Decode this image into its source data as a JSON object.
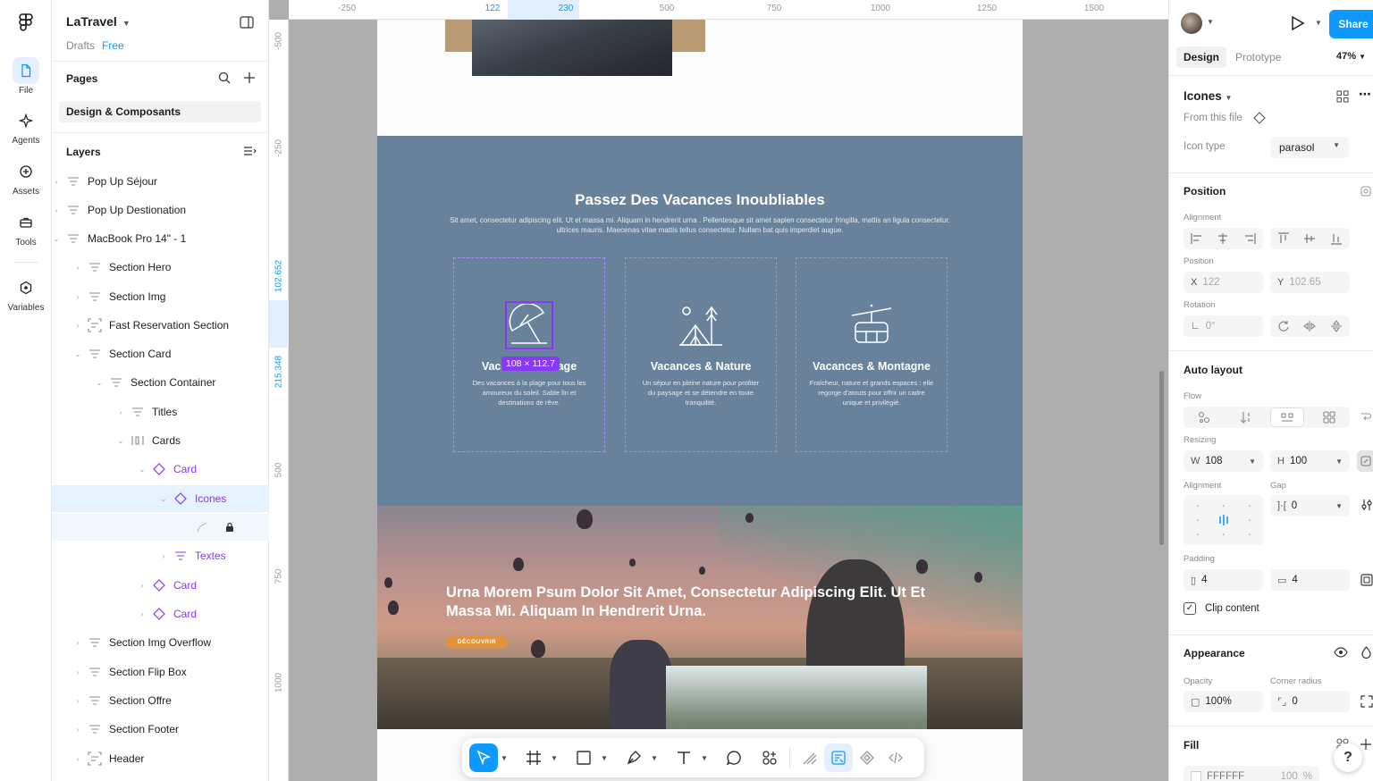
{
  "rail": {
    "items": [
      {
        "label": "File",
        "icon": "file-icon"
      },
      {
        "label": "Agents",
        "icon": "sparkle-icon"
      },
      {
        "label": "Assets",
        "icon": "assets-icon"
      },
      {
        "label": "Tools",
        "icon": "toolbox-icon"
      },
      {
        "label": "Variables",
        "icon": "variables-icon"
      }
    ]
  },
  "project": {
    "name": "LaTravel",
    "location": "Drafts",
    "plan": "Free"
  },
  "pages": {
    "title": "Pages",
    "current": "Design & Composants"
  },
  "layers": {
    "title": "Layers",
    "items": [
      {
        "label": "Pop Up Séjour"
      },
      {
        "label": "Pop Up Destionation"
      },
      {
        "label": "MacBook Pro 14\" - 1"
      },
      {
        "label": "Section Hero"
      },
      {
        "label": "Section Img"
      },
      {
        "label": "Fast Reservation Section"
      },
      {
        "label": "Section Card"
      },
      {
        "label": "Section Container"
      },
      {
        "label": "Titles"
      },
      {
        "label": "Cards"
      },
      {
        "label": "Card"
      },
      {
        "label": "Icones"
      },
      {
        "label": ""
      },
      {
        "label": "Textes"
      },
      {
        "label": "Card"
      },
      {
        "label": "Card"
      },
      {
        "label": "Section Img Overflow"
      },
      {
        "label": "Section Flip Box"
      },
      {
        "label": "Section Offre"
      },
      {
        "label": "Section Footer"
      },
      {
        "label": "Header"
      }
    ]
  },
  "ruler": {
    "top": [
      "-250",
      "122",
      "230",
      "500",
      "750",
      "1000",
      "1250",
      "1500"
    ],
    "left": [
      "-500",
      "-250",
      "102.652",
      "215.348",
      "500",
      "750",
      "1000"
    ]
  },
  "canvas": {
    "section_card": {
      "title": "Passez Des Vacances Inoubliables",
      "subtitle": "Sit amet, consectetur adipiscing elit. Ut et massa mi. Aliquam in hendrerit urna . Pellentesque sit amet sapien consectetur fringilla, mattis an ligula consectetur, ultrices mauris. Maecenas vitae mattis tellus consectetur. Nullam bat quis imperdiet augue.",
      "cards": [
        {
          "title": "Vacances & Plage",
          "text": "Des vacances à la plage pour tous les amoureux du soleil. Sable fin et destinations de rêve.",
          "icon": "parasol-icon"
        },
        {
          "title": "Vacances & Nature",
          "text": "Un séjour en pleine nature pour profiter du paysage et se détendre en toute tranquilité.",
          "icon": "tent-icon"
        },
        {
          "title": "Vacances & Montagne",
          "text": "Fraîcheur, nature et grands espaces : elle regorge d'atouts pour offrir un cadre unique et privilégié.",
          "icon": "cable-car-icon"
        }
      ],
      "selection_size": "108 × 112.7"
    },
    "section_img": {
      "title": "Urna Morem Psum Dolor Sit Amet, Consectetur Adipiscing Elit. Ut Et Massa Mi. Aliquam In Hendrerit Urna.",
      "button": "DÉCOUVRIR"
    }
  },
  "toolbar": {
    "tools": [
      "move-icon",
      "frame-icon",
      "rectangle-icon",
      "pen-icon",
      "text-icon",
      "comment-icon",
      "actions-icon",
      "draw-icon",
      "dev-annotate-icon",
      "component-icon",
      "code-icon"
    ]
  },
  "right_panel": {
    "share": "Share",
    "tabs": [
      "Design",
      "Prototype"
    ],
    "zoom": "47%",
    "component": {
      "name": "Icones",
      "source": "From this file",
      "prop_label": "Icon type",
      "prop_value": "parasol"
    },
    "position": {
      "title": "Position",
      "alignment_label": "Alignment",
      "position_label": "Position",
      "x_label": "X",
      "x": "122",
      "y_label": "Y",
      "y": "102.65",
      "rotation_label": "Rotation",
      "rotation": "0°"
    },
    "auto_layout": {
      "title": "Auto layout",
      "flow_label": "Flow",
      "resizing_label": "Resizing",
      "w_label": "W",
      "w": "108",
      "h_label": "H",
      "h": "100",
      "alignment_label": "Alignment",
      "gap_label": "Gap",
      "gap": "0",
      "padding_label": "Padding",
      "padding_h": "4",
      "padding_v": "4",
      "clip_label": "Clip content"
    },
    "appearance": {
      "title": "Appearance",
      "opacity_label": "Opacity",
      "opacity": "100%",
      "radius_label": "Corner radius",
      "radius": "0"
    },
    "fill": {
      "title": "Fill",
      "hex": "FFFFFF",
      "opacity": "100",
      "unit": "%"
    }
  },
  "colors": {
    "accent": "#0d99ff",
    "component": "#8a38f5",
    "section_card_bg": "#67829a",
    "button_orange": "#e0933b"
  }
}
